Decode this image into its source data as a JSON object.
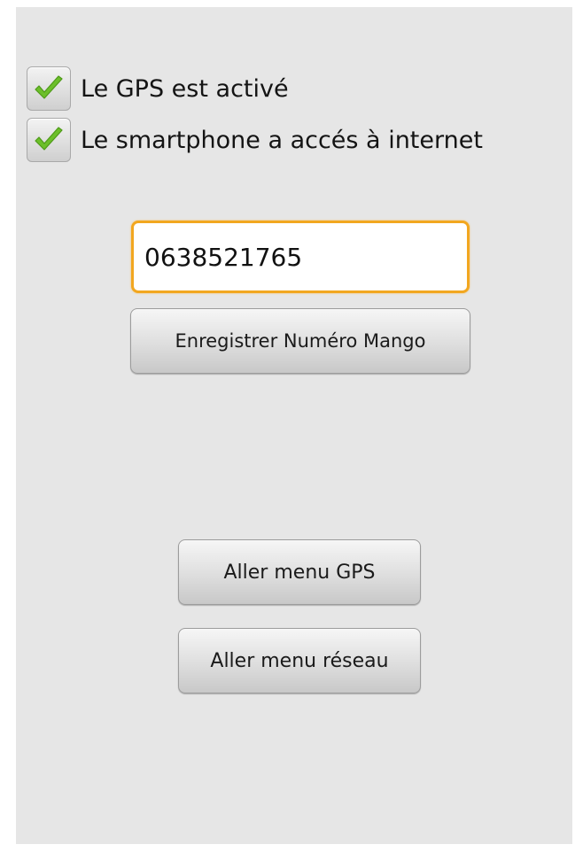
{
  "checks": [
    {
      "label": "Le GPS est activé",
      "checked": true,
      "icon": "checkmark-icon"
    },
    {
      "label": "Le smartphone a accés à internet",
      "checked": true,
      "icon": "checkmark-icon"
    }
  ],
  "phone_input": {
    "value": "0638521765"
  },
  "buttons": {
    "save_number": "Enregistrer Numéro Mango",
    "gps_menu": "Aller menu GPS",
    "network_menu": "Aller menu réseau"
  },
  "colors": {
    "background": "#e6e6e6",
    "focus_border": "#f2a720",
    "check_green": "#6cbf2a"
  }
}
